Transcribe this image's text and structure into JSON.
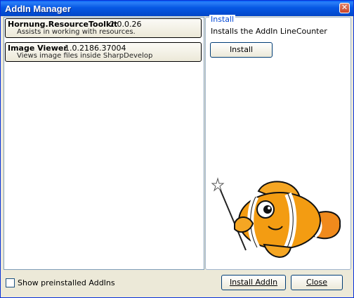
{
  "window": {
    "title": "AddIn Manager"
  },
  "addins": [
    {
      "name": "Hornung.ResourceToolkit",
      "version": "2.0.0.26",
      "description": "Assists in working with resources."
    },
    {
      "name": "Image Viewer",
      "version": "1.0.2186.37004",
      "description": "Views image files inside SharpDevelop"
    }
  ],
  "install_panel": {
    "legend": "Install",
    "description": "Installs the AddIn LineCounter",
    "install_button": "Install"
  },
  "footer": {
    "show_preinstalled_label": "Show preinstalled AddIns",
    "show_preinstalled_checked": false,
    "install_addin_button": "Install AddIn",
    "close_button": "Close"
  },
  "colors": {
    "titlebar": "#0454e0",
    "dialog_bg": "#ece9d8",
    "legend_text": "#0046d5"
  }
}
